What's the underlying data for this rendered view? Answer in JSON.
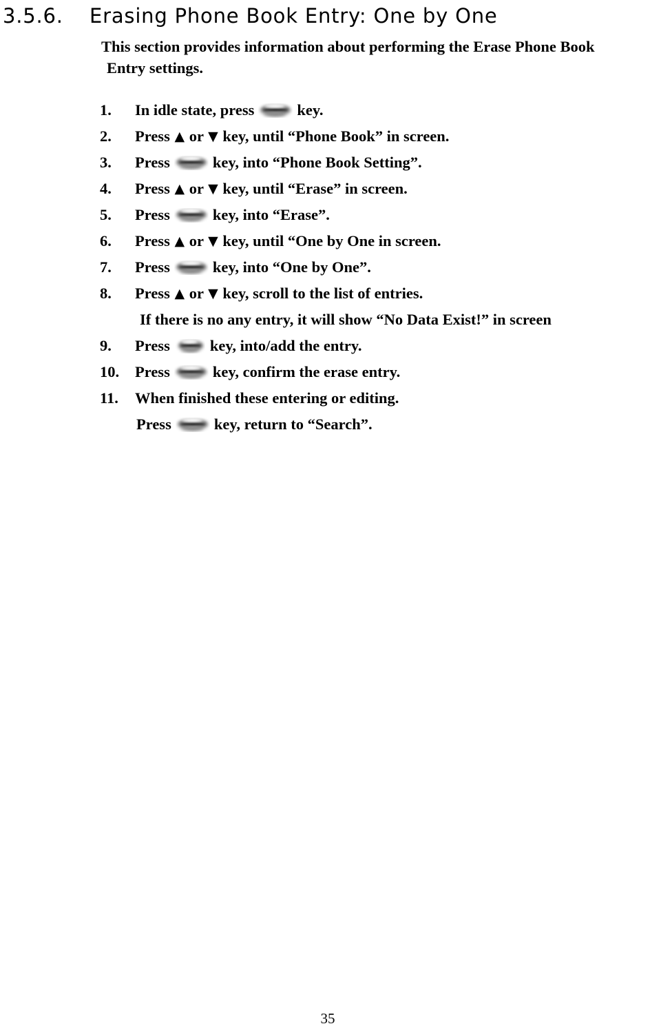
{
  "document": {
    "heading": {
      "number": "3.5.6.",
      "title": "Erasing Phone Book Entry: One by One"
    },
    "intro": {
      "line1": "This section provides information about performing the Erase Phone Book",
      "line2": "Entry settings."
    },
    "icons": {
      "ok_key": "oval-key-button-image",
      "up_arrow": "▲",
      "down_arrow": "▼"
    },
    "steps": [
      {
        "number": "1.",
        "parts": [
          {
            "type": "text",
            "value": "In idle state, press"
          },
          {
            "type": "key"
          },
          {
            "type": "text",
            "value": "key."
          }
        ]
      },
      {
        "number": "2.",
        "parts": [
          {
            "type": "text",
            "value": "Press"
          },
          {
            "type": "arrow",
            "value": "▲"
          },
          {
            "type": "text",
            "value": "or"
          },
          {
            "type": "arrow",
            "value": "▼"
          },
          {
            "type": "text",
            "value": "key, until “Phone Book” in screen."
          }
        ]
      },
      {
        "number": "3.",
        "parts": [
          {
            "type": "text",
            "value": "Press"
          },
          {
            "type": "key"
          },
          {
            "type": "text",
            "value": "key, into “Phone Book Setting”."
          }
        ]
      },
      {
        "number": "4.",
        "parts": [
          {
            "type": "text",
            "value": "Press"
          },
          {
            "type": "arrow",
            "value": "▲"
          },
          {
            "type": "text",
            "value": "or"
          },
          {
            "type": "arrow",
            "value": "▼"
          },
          {
            "type": "text",
            "value": "key, until “Erase” in screen."
          }
        ]
      },
      {
        "number": "5.",
        "parts": [
          {
            "type": "text",
            "value": "Press"
          },
          {
            "type": "key"
          },
          {
            "type": "text",
            "value": "key, into “Erase”."
          }
        ]
      },
      {
        "number": "6.",
        "parts": [
          {
            "type": "text",
            "value": "Press"
          },
          {
            "type": "arrow",
            "value": "▲"
          },
          {
            "type": "text",
            "value": "or"
          },
          {
            "type": "arrow",
            "value": "▼"
          },
          {
            "type": "text",
            "value": "key, until “One by One in screen."
          }
        ]
      },
      {
        "number": "7.",
        "parts": [
          {
            "type": "text",
            "value": "Press"
          },
          {
            "type": "key"
          },
          {
            "type": "text",
            "value": "key, into “One by One”."
          }
        ]
      },
      {
        "number": "8.",
        "parts": [
          {
            "type": "text",
            "value": "Press"
          },
          {
            "type": "arrow",
            "value": "▲"
          },
          {
            "type": "text",
            "value": "or"
          },
          {
            "type": "arrow",
            "value": "▼"
          },
          {
            "type": "text",
            "value": "key, scroll to the list of entries."
          }
        ]
      },
      {
        "number": "",
        "note": true,
        "indent": "a",
        "parts": [
          {
            "type": "text",
            "value": "If there is no any entry, it will show “No Data Exist!” in screen"
          }
        ]
      },
      {
        "number": "9.",
        "parts": [
          {
            "type": "text",
            "value": "Press"
          },
          {
            "type": "key",
            "variant": "narrow"
          },
          {
            "type": "text",
            "value": "key, into/add the entry."
          }
        ]
      },
      {
        "number": "10.",
        "parts": [
          {
            "type": "text",
            "value": "Press"
          },
          {
            "type": "key"
          },
          {
            "type": "text",
            "value": "key, confirm the erase entry."
          }
        ]
      },
      {
        "number": "11.",
        "parts": [
          {
            "type": "text",
            "value": "When finished these entering or editing."
          }
        ]
      },
      {
        "number": "",
        "note": true,
        "indent": "b",
        "parts": [
          {
            "type": "text",
            "value": "Press"
          },
          {
            "type": "key"
          },
          {
            "type": "text",
            "value": "key, return to “Search”."
          }
        ]
      }
    ],
    "footer": {
      "page_number": "35"
    }
  }
}
